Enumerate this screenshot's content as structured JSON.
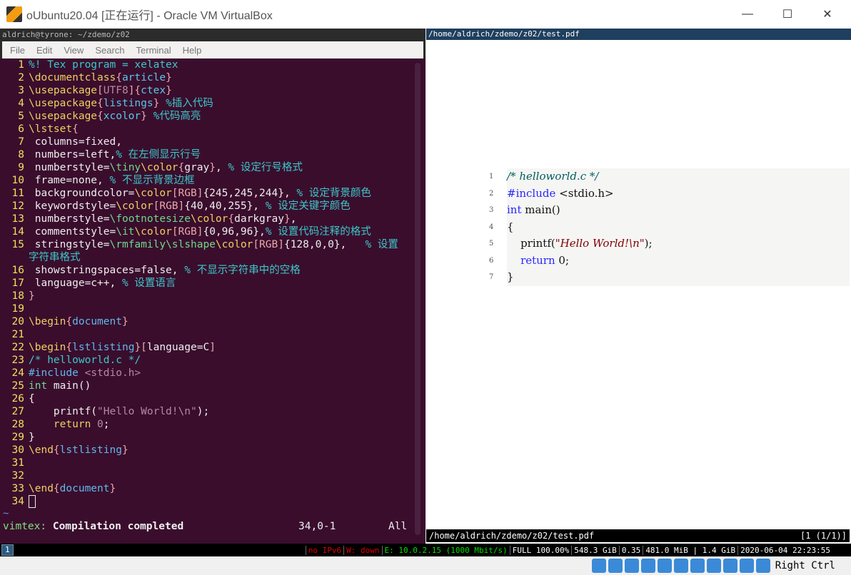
{
  "window": {
    "title": "oUbuntu20.04 [正在运行] - Oracle VM VirtualBox",
    "minimize": "—",
    "maximize": "☐",
    "close": "✕"
  },
  "terminal": {
    "title": "aldrich@tyrone: ~/zdemo/z02",
    "menu": [
      "File",
      "Edit",
      "View",
      "Search",
      "Terminal",
      "Help"
    ]
  },
  "editor": {
    "lines": [
      [
        [
          "%! Tex program = xelatex",
          "c"
        ]
      ],
      [
        [
          "\\documentclass",
          "k"
        ],
        [
          "{",
          "b"
        ],
        [
          "article",
          "a"
        ],
        [
          "}",
          "b"
        ]
      ],
      [
        [
          "\\usepackage",
          "k"
        ],
        [
          "[",
          "b"
        ],
        [
          "UTF8",
          "o"
        ],
        [
          "]",
          "b"
        ],
        [
          "{",
          "b"
        ],
        [
          "ctex",
          "a"
        ],
        [
          "}",
          "b"
        ]
      ],
      [
        [
          "\\usepackage",
          "k"
        ],
        [
          "{",
          "b"
        ],
        [
          "listings",
          "a"
        ],
        [
          "}",
          "b"
        ],
        [
          " %插入代码",
          "c"
        ]
      ],
      [
        [
          "\\usepackage",
          "k"
        ],
        [
          "{",
          "b"
        ],
        [
          "xcolor",
          "a"
        ],
        [
          "}",
          "b"
        ],
        [
          " %代码高亮",
          "c"
        ]
      ],
      [
        [
          "\\lstset",
          "k"
        ],
        [
          "{",
          "b"
        ]
      ],
      [
        [
          " columns=fixed,",
          "t"
        ]
      ],
      [
        [
          " numbers=left,",
          "t"
        ],
        [
          "% 在左侧显示行号",
          "c"
        ]
      ],
      [
        [
          " numberstyle=",
          "t"
        ],
        [
          "\\tiny",
          "g"
        ],
        [
          "\\color",
          "k"
        ],
        [
          "{",
          "b"
        ],
        [
          "gray",
          "t"
        ],
        [
          "}",
          "b"
        ],
        [
          ", ",
          "t"
        ],
        [
          "% 设定行号格式",
          "c"
        ]
      ],
      [
        [
          " frame=none, ",
          "t"
        ],
        [
          "% 不显示背景边框",
          "c"
        ]
      ],
      [
        [
          " backgroundcolor=",
          "t"
        ],
        [
          "\\color",
          "k"
        ],
        [
          "[RGB]",
          "b"
        ],
        [
          "{245,245,244}",
          "t"
        ],
        [
          ", ",
          "t"
        ],
        [
          "% 设定背景颜色",
          "c"
        ]
      ],
      [
        [
          " keywordstyle=",
          "t"
        ],
        [
          "\\color",
          "k"
        ],
        [
          "[RGB]",
          "b"
        ],
        [
          "{40,40,255}",
          "t"
        ],
        [
          ", ",
          "t"
        ],
        [
          "% 设定关键字颜色",
          "c"
        ]
      ],
      [
        [
          " numberstyle=",
          "t"
        ],
        [
          "\\footnotesize",
          "g"
        ],
        [
          "\\color",
          "k"
        ],
        [
          "{",
          "b"
        ],
        [
          "darkgray",
          "t"
        ],
        [
          "}",
          "b"
        ],
        [
          ",",
          "t"
        ]
      ],
      [
        [
          " commentstyle=",
          "t"
        ],
        [
          "\\it",
          "g"
        ],
        [
          "\\color",
          "k"
        ],
        [
          "[RGB]",
          "b"
        ],
        [
          "{0,96,96}",
          "t"
        ],
        [
          ",",
          "t"
        ],
        [
          "% 设置代码注释的格式",
          "c"
        ]
      ],
      [
        [
          " stringstyle=",
          "t"
        ],
        [
          "\\rmfamily",
          "g"
        ],
        [
          "\\slshape",
          "g"
        ],
        [
          "\\color",
          "k"
        ],
        [
          "[RGB]",
          "b"
        ],
        [
          "{128,0,0}",
          "t"
        ],
        [
          ",   ",
          "t"
        ],
        [
          "% 设置",
          "c"
        ]
      ],
      [
        [
          "字符串格式",
          "c"
        ]
      ],
      [
        [
          " showstringspaces=false, ",
          "t"
        ],
        [
          "% 不显示字符串中的空格",
          "c"
        ]
      ],
      [
        [
          " language=c++, ",
          "t"
        ],
        [
          "% 设置语言",
          "c"
        ]
      ],
      [
        [
          "}",
          "b"
        ]
      ],
      [],
      [
        [
          "\\begin",
          "k"
        ],
        [
          "{",
          "b"
        ],
        [
          "document",
          "h"
        ],
        [
          "}",
          "b"
        ]
      ],
      [],
      [
        [
          "\\begin",
          "k"
        ],
        [
          "{",
          "b"
        ],
        [
          "lstlisting",
          "h"
        ],
        [
          "}",
          "b"
        ],
        [
          "[",
          "b"
        ],
        [
          "language=C",
          "t"
        ],
        [
          "]",
          "b"
        ]
      ],
      [
        [
          "/* helloworld.c */",
          "c"
        ]
      ],
      [
        [
          "#include",
          "h"
        ],
        [
          " <stdio.h>",
          "o"
        ]
      ],
      [
        [
          "int",
          "g"
        ],
        [
          " main()",
          "t"
        ]
      ],
      [
        [
          "{",
          "t"
        ]
      ],
      [
        [
          "    printf(",
          "t"
        ],
        [
          "\"Hello World!\\n\"",
          "o"
        ],
        [
          ");",
          "t"
        ]
      ],
      [
        [
          "    return",
          "k"
        ],
        [
          " 0",
          "o"
        ],
        [
          ";",
          "t"
        ]
      ],
      [
        [
          "}",
          "t"
        ]
      ],
      [
        [
          "\\end",
          "k"
        ],
        [
          "{",
          "b"
        ],
        [
          "lstlisting",
          "h"
        ],
        [
          "}",
          "b"
        ]
      ],
      [],
      [],
      [
        [
          "\\end",
          "k"
        ],
        [
          "{",
          "b"
        ],
        [
          "document",
          "h"
        ],
        [
          "}",
          "b"
        ]
      ],
      []
    ],
    "line_numbers": [
      "1",
      "2",
      "3",
      "4",
      "5",
      "6",
      "7",
      "8",
      "9",
      "10",
      "11",
      "12",
      "13",
      "14",
      "15",
      "",
      "16",
      "17",
      "18",
      "19",
      "20",
      "21",
      "22",
      "23",
      "24",
      "25",
      "26",
      "27",
      "28",
      "29",
      "30",
      "31",
      "32",
      "33",
      "34"
    ],
    "tilde": "~",
    "status_label": "vimtex:",
    "status_msg": "Compilation completed",
    "position": "34,0-1",
    "scroll": "All"
  },
  "pdf": {
    "path": "/home/aldrich/zdemo/z02/test.pdf",
    "page": "[1 (1/1)]",
    "line_numbers": [
      "1",
      "2",
      "3",
      "4",
      "5",
      "6",
      "7"
    ],
    "lines": [
      [
        [
          "/* helloworld.c */",
          "pc"
        ]
      ],
      [
        [
          "#include",
          "pk"
        ],
        [
          " <stdio.h>",
          ""
        ]
      ],
      [
        [
          "int",
          "pk"
        ],
        [
          " main()",
          ""
        ]
      ],
      [
        [
          "{",
          ""
        ]
      ],
      [
        [
          "    printf(",
          ""
        ],
        [
          "\"Hello World!\\n\"",
          "ps"
        ],
        [
          ");",
          ""
        ]
      ],
      [
        [
          "    return",
          "pk"
        ],
        [
          " 0;",
          ""
        ]
      ],
      [
        [
          "}",
          ""
        ]
      ]
    ]
  },
  "statusbar": {
    "workspace": "1",
    "items": [
      {
        "text": "no IPv6",
        "color": "#e00000"
      },
      {
        "text": "W: down",
        "color": "#e00000"
      },
      {
        "text": "E: 10.0.2.15 (1000 Mbit/s)",
        "color": "#00e000"
      },
      {
        "text": "FULL 100.00%",
        "color": "#ffffff"
      },
      {
        "text": "548.3 GiB",
        "color": "#ffffff"
      },
      {
        "text": "0.35",
        "color": "#ffffff"
      },
      {
        "text": "481.0 MiB | 1.4 GiB",
        "color": "#ffffff"
      },
      {
        "text": "2020-06-04 22:23:55",
        "color": "#ffffff"
      }
    ]
  },
  "vbox": {
    "host_key": "Right Ctrl",
    "icons": [
      "hard-disk-icon",
      "optical-disk-icon",
      "audio-icon",
      "network-icon",
      "usb-icon",
      "shared-folders-icon",
      "display-icon",
      "video-capture-icon",
      "virtualization-icon",
      "mouse-integration-icon",
      "download-icon"
    ]
  }
}
